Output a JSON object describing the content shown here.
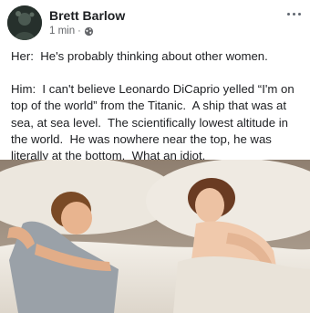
{
  "post": {
    "author": "Brett Barlow",
    "timestamp": "1 min",
    "separator": "·",
    "privacy_icon": "globe-icon",
    "more_icon": "more-options-icon",
    "body_paragraphs": [
      "Her:  He's probably thinking about other women.",
      "Him:  I can't believe Leonardo DiCaprio yelled “I'm on top of the world” from the Titanic.  A ship that was at sea, at sea level.  The scientifically lowest altitude in the world.  He was nowhere near the top, he was literally at the bottom.  What an idiot."
    ],
    "image": "couple-in-bed-photo"
  }
}
